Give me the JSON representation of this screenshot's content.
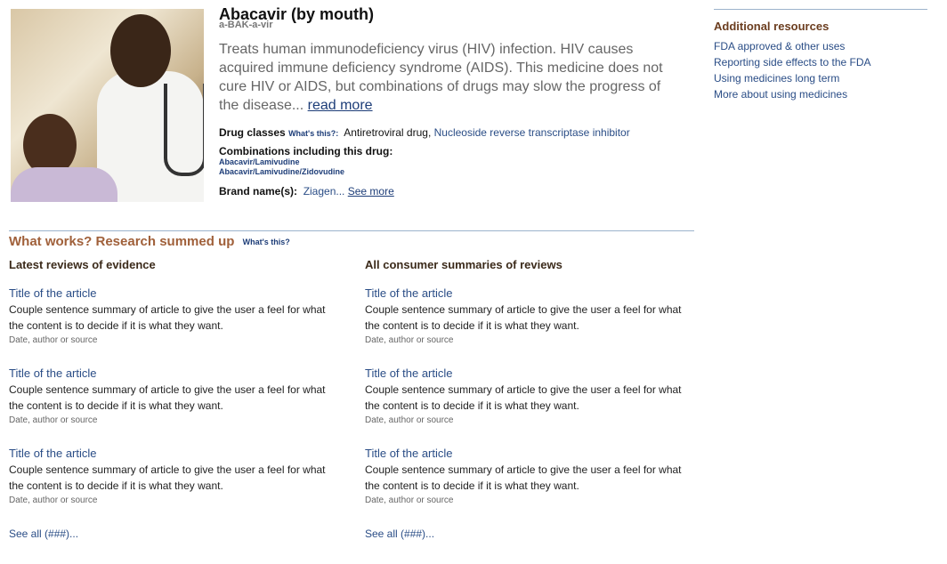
{
  "drug": {
    "title": "Abacavir (by mouth)",
    "pronunciation": "a-BAK-a-vir",
    "description": "Treats human immunodeficiency virus (HIV) infection. HIV causes acquired immune deficiency syndrome (AIDS). This medicine does not cure HIV or AIDS, but combinations of drugs may slow the progress of the disease...",
    "read_more": "read more",
    "drug_classes_label": "Drug classes",
    "whats_this": "What's this?:",
    "drug_classes": [
      "Antiretroviral drug",
      "Nucleoside reverse transcriptase inhibitor"
    ],
    "combinations_label": "Combinations including this drug:",
    "combinations": [
      "Abacavir/Lamivudine",
      "Abacavir/Lamivudine/Zidovudine"
    ],
    "brand_label": "Brand name(s):",
    "brand_value": "Ziagen...",
    "see_more": "See more"
  },
  "resources": {
    "title": "Additional resources",
    "items": [
      "FDA approved & other uses",
      "Reporting side effects to the FDA",
      "Using medicines long term",
      "More about using medicines"
    ]
  },
  "research": {
    "title": "What works? Research summed up",
    "whats_this": "What's this?",
    "left": {
      "heading": "Latest reviews of evidence",
      "articles": [
        {
          "title": "Title of the article",
          "summary": "Couple sentence summary of article to give the user a feel for what the content is to decide if it is what they want.",
          "meta": "Date, author or source"
        },
        {
          "title": "Title of the article",
          "summary": "Couple sentence summary of article to give the user a feel for what the content is to decide if it is what they want.",
          "meta": "Date, author or source"
        },
        {
          "title": "Title of the article",
          "summary": "Couple sentence summary of article to give the user a feel for what the content is to decide if it is what they want.",
          "meta": "Date, author or source"
        }
      ],
      "see_all": "See all (###)..."
    },
    "right": {
      "heading": "All consumer summaries of reviews",
      "articles": [
        {
          "title": "Title of the article",
          "summary": "Couple sentence summary of article to give the user a feel for what the content is to decide if it is what they want.",
          "meta": "Date, author or source"
        },
        {
          "title": "Title of the article",
          "summary": "Couple sentence summary of article to give the user a feel for what the content is to decide if it is what they want.",
          "meta": "Date, author or source"
        },
        {
          "title": "Title of the article",
          "summary": "Couple sentence summary of article to give the user a feel for what the content is to decide if it is what they want.",
          "meta": "Date, author or source"
        }
      ],
      "see_all": "See all (###)..."
    }
  },
  "colors": {
    "link": "#2a4d86",
    "section_title": "#a0603a",
    "heading": "#3b2a1a",
    "divider": "#9cb3cc"
  }
}
